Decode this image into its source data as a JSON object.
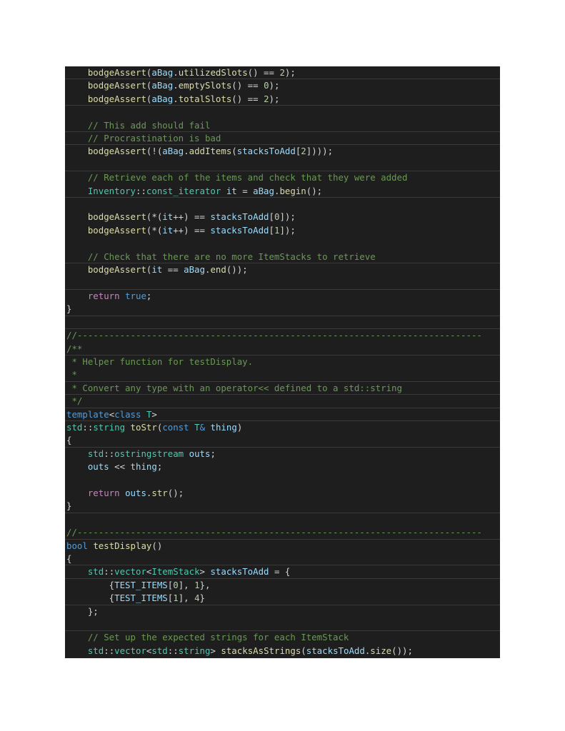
{
  "colors": {
    "background": "#1e1e1e",
    "page": "#ffffff",
    "comment": "#6a9955",
    "keyword": "#569cd6",
    "control": "#c586c0",
    "type": "#4ec9b0",
    "function": "#dcdcaa",
    "variable": "#9cdcfe",
    "number": "#b5cea8",
    "plain": "#d4d4d4"
  },
  "code": {
    "language": "cpp",
    "lines": [
      {
        "rule": true,
        "tokens": [
          [
            "plain",
            "    "
          ],
          [
            "func",
            "bodgeAssert"
          ],
          [
            "plain",
            "("
          ],
          [
            "var",
            "aBag"
          ],
          [
            "plain",
            "."
          ],
          [
            "func",
            "utilizedSlots"
          ],
          [
            "plain",
            "() == "
          ],
          [
            "number",
            "2"
          ],
          [
            "plain",
            ");"
          ]
        ]
      },
      {
        "rule": false,
        "tokens": [
          [
            "plain",
            "    "
          ],
          [
            "func",
            "bodgeAssert"
          ],
          [
            "plain",
            "("
          ],
          [
            "var",
            "aBag"
          ],
          [
            "plain",
            "."
          ],
          [
            "func",
            "emptySlots"
          ],
          [
            "plain",
            "() == "
          ],
          [
            "number",
            "0"
          ],
          [
            "plain",
            ");"
          ]
        ]
      },
      {
        "rule": true,
        "tokens": [
          [
            "plain",
            "    "
          ],
          [
            "func",
            "bodgeAssert"
          ],
          [
            "plain",
            "("
          ],
          [
            "var",
            "aBag"
          ],
          [
            "plain",
            "."
          ],
          [
            "func",
            "totalSlots"
          ],
          [
            "plain",
            "() == "
          ],
          [
            "number",
            "2"
          ],
          [
            "plain",
            ");"
          ]
        ]
      },
      {
        "rule": false,
        "tokens": []
      },
      {
        "rule": true,
        "tokens": [
          [
            "plain",
            "    "
          ],
          [
            "comment",
            "// This add should fail"
          ]
        ]
      },
      {
        "rule": true,
        "tokens": [
          [
            "plain",
            "    "
          ],
          [
            "comment",
            "// Procrastination is bad"
          ]
        ]
      },
      {
        "rule": false,
        "tokens": [
          [
            "plain",
            "    "
          ],
          [
            "func",
            "bodgeAssert"
          ],
          [
            "plain",
            "(!("
          ],
          [
            "var",
            "aBag"
          ],
          [
            "plain",
            "."
          ],
          [
            "func",
            "addItems"
          ],
          [
            "plain",
            "("
          ],
          [
            "var",
            "stacksToAdd"
          ],
          [
            "plain",
            "["
          ],
          [
            "number",
            "2"
          ],
          [
            "plain",
            "])));"
          ]
        ]
      },
      {
        "rule": true,
        "tokens": []
      },
      {
        "rule": false,
        "tokens": [
          [
            "plain",
            "    "
          ],
          [
            "comment",
            "// Retrieve each of the items and check that they were added"
          ]
        ]
      },
      {
        "rule": true,
        "tokens": [
          [
            "plain",
            "    "
          ],
          [
            "type",
            "Inventory"
          ],
          [
            "plain",
            "::"
          ],
          [
            "type",
            "const_iterator"
          ],
          [
            "plain",
            " "
          ],
          [
            "var",
            "it"
          ],
          [
            "plain",
            " = "
          ],
          [
            "var",
            "aBag"
          ],
          [
            "plain",
            "."
          ],
          [
            "func",
            "begin"
          ],
          [
            "plain",
            "();"
          ]
        ]
      },
      {
        "rule": false,
        "tokens": []
      },
      {
        "rule": false,
        "tokens": [
          [
            "plain",
            "    "
          ],
          [
            "func",
            "bodgeAssert"
          ],
          [
            "plain",
            "(*("
          ],
          [
            "var",
            "it"
          ],
          [
            "plain",
            "++) == "
          ],
          [
            "var",
            "stacksToAdd"
          ],
          [
            "plain",
            "["
          ],
          [
            "number",
            "0"
          ],
          [
            "plain",
            "]);"
          ]
        ]
      },
      {
        "rule": false,
        "tokens": [
          [
            "plain",
            "    "
          ],
          [
            "func",
            "bodgeAssert"
          ],
          [
            "plain",
            "(*("
          ],
          [
            "var",
            "it"
          ],
          [
            "plain",
            "++) == "
          ],
          [
            "var",
            "stacksToAdd"
          ],
          [
            "plain",
            "["
          ],
          [
            "number",
            "1"
          ],
          [
            "plain",
            "]);"
          ]
        ]
      },
      {
        "rule": false,
        "tokens": []
      },
      {
        "rule": true,
        "tokens": [
          [
            "plain",
            "    "
          ],
          [
            "comment",
            "// Check that there are no more ItemStacks to retrieve"
          ]
        ]
      },
      {
        "rule": false,
        "tokens": [
          [
            "plain",
            "    "
          ],
          [
            "func",
            "bodgeAssert"
          ],
          [
            "plain",
            "("
          ],
          [
            "var",
            "it"
          ],
          [
            "plain",
            " == "
          ],
          [
            "var",
            "aBag"
          ],
          [
            "plain",
            "."
          ],
          [
            "func",
            "end"
          ],
          [
            "plain",
            "());"
          ]
        ]
      },
      {
        "rule": true,
        "tokens": []
      },
      {
        "rule": false,
        "tokens": [
          [
            "plain",
            "    "
          ],
          [
            "control",
            "return"
          ],
          [
            "plain",
            " "
          ],
          [
            "keyword",
            "true"
          ],
          [
            "plain",
            ";"
          ]
        ]
      },
      {
        "rule": true,
        "tokens": [
          [
            "plain",
            "}"
          ]
        ]
      },
      {
        "rule": true,
        "tokens": []
      },
      {
        "rule": false,
        "tokens": [
          [
            "comment",
            "//----------------------------------------------------------------------------"
          ]
        ]
      },
      {
        "rule": true,
        "tokens": [
          [
            "comment",
            "/**"
          ]
        ]
      },
      {
        "rule": false,
        "tokens": [
          [
            "comment",
            " * Helper function for testDisplay."
          ]
        ]
      },
      {
        "rule": true,
        "tokens": [
          [
            "comment",
            " *"
          ]
        ]
      },
      {
        "rule": true,
        "tokens": [
          [
            "comment",
            " * Convert any type with an operator<< defined to a std::string"
          ]
        ]
      },
      {
        "rule": true,
        "tokens": [
          [
            "comment",
            " */"
          ]
        ]
      },
      {
        "rule": true,
        "tokens": [
          [
            "keyword",
            "template"
          ],
          [
            "plain",
            "<"
          ],
          [
            "keyword",
            "class"
          ],
          [
            "plain",
            " "
          ],
          [
            "type",
            "T"
          ],
          [
            "plain",
            ">"
          ]
        ]
      },
      {
        "rule": false,
        "tokens": [
          [
            "type",
            "std"
          ],
          [
            "plain",
            "::"
          ],
          [
            "type",
            "string"
          ],
          [
            "plain",
            " "
          ],
          [
            "func",
            "toStr"
          ],
          [
            "plain",
            "("
          ],
          [
            "keyword",
            "const"
          ],
          [
            "plain",
            " "
          ],
          [
            "type",
            "T"
          ],
          [
            "keyword",
            "&"
          ],
          [
            "plain",
            " "
          ],
          [
            "var",
            "thing"
          ],
          [
            "plain",
            ")"
          ]
        ]
      },
      {
        "rule": true,
        "tokens": [
          [
            "plain",
            "{"
          ]
        ]
      },
      {
        "rule": false,
        "tokens": [
          [
            "plain",
            "    "
          ],
          [
            "type",
            "std"
          ],
          [
            "plain",
            "::"
          ],
          [
            "type",
            "ostringstream"
          ],
          [
            "plain",
            " "
          ],
          [
            "var",
            "outs"
          ],
          [
            "plain",
            ";"
          ]
        ]
      },
      {
        "rule": false,
        "tokens": [
          [
            "plain",
            "    "
          ],
          [
            "var",
            "outs"
          ],
          [
            "plain",
            " << "
          ],
          [
            "var",
            "thing"
          ],
          [
            "plain",
            ";"
          ]
        ]
      },
      {
        "rule": false,
        "tokens": []
      },
      {
        "rule": false,
        "tokens": [
          [
            "plain",
            "    "
          ],
          [
            "control",
            "return"
          ],
          [
            "plain",
            " "
          ],
          [
            "var",
            "outs"
          ],
          [
            "plain",
            "."
          ],
          [
            "func",
            "str"
          ],
          [
            "plain",
            "();"
          ]
        ]
      },
      {
        "rule": true,
        "tokens": [
          [
            "plain",
            "}"
          ]
        ]
      },
      {
        "rule": false,
        "tokens": []
      },
      {
        "rule": true,
        "tokens": [
          [
            "comment",
            "//----------------------------------------------------------------------------"
          ]
        ]
      },
      {
        "rule": false,
        "tokens": [
          [
            "keyword",
            "bool"
          ],
          [
            "plain",
            " "
          ],
          [
            "func",
            "testDisplay"
          ],
          [
            "plain",
            "()"
          ]
        ]
      },
      {
        "rule": true,
        "tokens": [
          [
            "plain",
            "{"
          ]
        ]
      },
      {
        "rule": true,
        "tokens": [
          [
            "plain",
            "    "
          ],
          [
            "type",
            "std"
          ],
          [
            "plain",
            "::"
          ],
          [
            "type",
            "vector"
          ],
          [
            "plain",
            "<"
          ],
          [
            "type",
            "ItemStack"
          ],
          [
            "plain",
            "> "
          ],
          [
            "var",
            "stacksToAdd"
          ],
          [
            "plain",
            " = {"
          ]
        ]
      },
      {
        "rule": false,
        "tokens": [
          [
            "plain",
            "        {"
          ],
          [
            "var",
            "TEST_ITEMS"
          ],
          [
            "plain",
            "["
          ],
          [
            "number",
            "0"
          ],
          [
            "plain",
            "], "
          ],
          [
            "number",
            "1"
          ],
          [
            "plain",
            "},"
          ]
        ]
      },
      {
        "rule": true,
        "tokens": [
          [
            "plain",
            "        {"
          ],
          [
            "var",
            "TEST_ITEMS"
          ],
          [
            "plain",
            "["
          ],
          [
            "number",
            "1"
          ],
          [
            "plain",
            "], "
          ],
          [
            "number",
            "4"
          ],
          [
            "plain",
            "}"
          ]
        ]
      },
      {
        "rule": false,
        "tokens": [
          [
            "plain",
            "    };"
          ]
        ]
      },
      {
        "rule": true,
        "tokens": []
      },
      {
        "rule": false,
        "tokens": [
          [
            "plain",
            "    "
          ],
          [
            "comment",
            "// Set up the expected strings for each ItemStack"
          ]
        ]
      },
      {
        "rule": false,
        "tokens": [
          [
            "plain",
            "    "
          ],
          [
            "type",
            "std"
          ],
          [
            "plain",
            "::"
          ],
          [
            "type",
            "vector"
          ],
          [
            "plain",
            "<"
          ],
          [
            "type",
            "std"
          ],
          [
            "plain",
            "::"
          ],
          [
            "type",
            "string"
          ],
          [
            "plain",
            "> "
          ],
          [
            "func",
            "stacksAsStrings"
          ],
          [
            "plain",
            "("
          ],
          [
            "var",
            "stacksToAdd"
          ],
          [
            "plain",
            "."
          ],
          [
            "func",
            "size"
          ],
          [
            "plain",
            "());"
          ]
        ]
      }
    ]
  }
}
